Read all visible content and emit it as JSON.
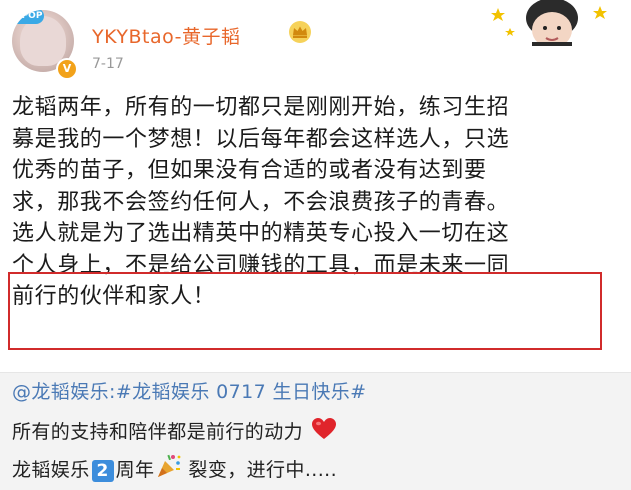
{
  "post": {
    "avatar_badge": "C·POP",
    "username": "YKYBtao-黄子韬",
    "date": "7-17",
    "body_lines": [
      "龙韬两年，所有的一切都只是刚刚开始，练习生招",
      "募是我的一个梦想！以后每年都会这样选人，只选",
      "优秀的苗子，但如果没有合适的或者没有达到要",
      "求，那我不会签约任何人，不会浪费孩子的青春。",
      "选人就是为了选出精英中的精英专心投入一切在这",
      "个人身上，不是给公司赚钱的工具，而是未来一同",
      "前行的伙伴和家人！"
    ],
    "highlight_color": "#d12b2b",
    "username_color": "#e8672b"
  },
  "repost": {
    "line1": "@龙韬娱乐:#龙韬娱乐 0717 生日快乐#",
    "line2": "所有的支持和陪伴都是前行的动力",
    "line3_pre": "龙韬娱乐",
    "line3_num": "2",
    "line3_mid": "周年",
    "line3_post": "裂变，进行中.....",
    "link_color": "#4a79b5"
  },
  "icons": [
    "vip-badge-icon",
    "crown-icon",
    "heart-icon",
    "party-popper-icon",
    "number-2-icon",
    "sticker-image"
  ]
}
